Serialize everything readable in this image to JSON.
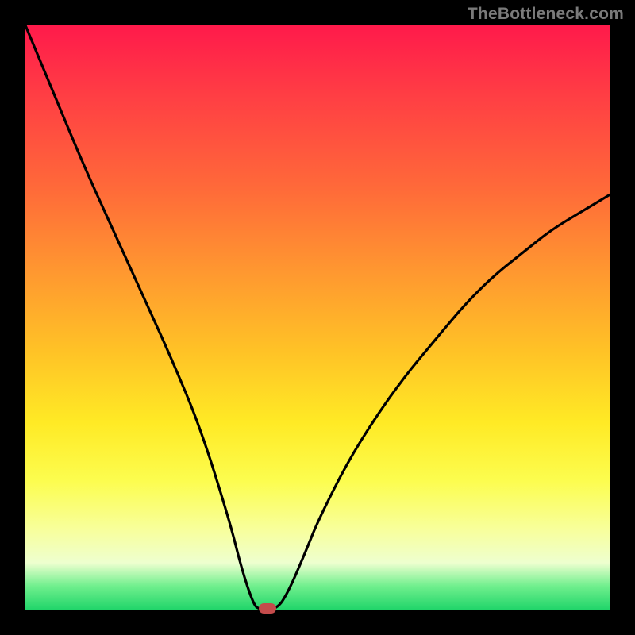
{
  "watermark": "TheBottleneck.com",
  "chart_data": {
    "type": "line",
    "title": "",
    "xlabel": "",
    "ylabel": "",
    "xlim": [
      0,
      100
    ],
    "ylim": [
      0,
      100
    ],
    "grid": false,
    "legend": false,
    "background_gradient": {
      "top_color": "#ff1a4b",
      "mid_color": "#ffea25",
      "bottom_color": "#21d56a"
    },
    "series": [
      {
        "name": "bottleneck-curve",
        "color": "#000000",
        "x": [
          0,
          5,
          10,
          15,
          20,
          25,
          30,
          35,
          37,
          39,
          40,
          43,
          45,
          48,
          50,
          55,
          60,
          65,
          70,
          75,
          80,
          85,
          90,
          95,
          100
        ],
        "values": [
          100,
          88,
          76,
          65,
          54,
          43,
          31,
          15,
          7,
          1,
          0,
          0,
          3,
          10,
          15,
          25,
          33,
          40,
          46,
          52,
          57,
          61,
          65,
          68,
          71
        ]
      }
    ],
    "marker": {
      "name": "optimal-point",
      "x": 41.5,
      "y": 0,
      "color": "#c44b4b"
    }
  }
}
